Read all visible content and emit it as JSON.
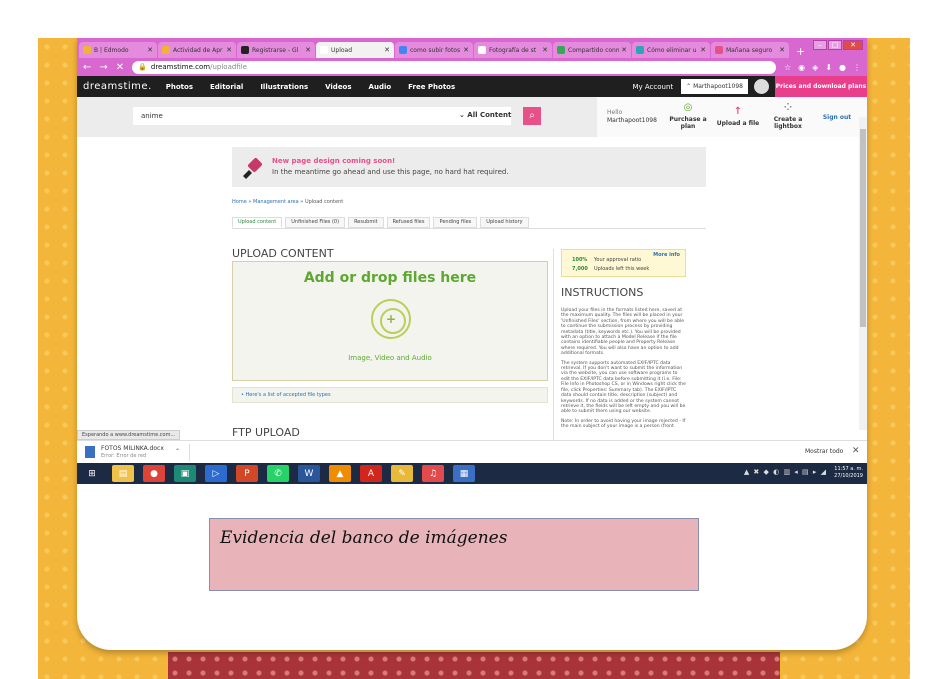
{
  "browser": {
    "tabs": [
      {
        "label": "B | Edmodo",
        "icon_color": "#f2b233",
        "active": false
      },
      {
        "label": "Actividad de Apr",
        "icon_color": "#f2b233",
        "active": false
      },
      {
        "label": "Registrarse - Gl",
        "icon_color": "#222222",
        "active": false
      },
      {
        "label": "Upload",
        "icon_color": "#ffffff",
        "active": true
      },
      {
        "label": "como subir fotos",
        "icon_color": "#4285f4",
        "active": false
      },
      {
        "label": "Fotografía de st",
        "icon_color": "#ffffff",
        "active": false
      },
      {
        "label": "Compartido conm",
        "icon_color": "#34a853",
        "active": false
      },
      {
        "label": "Cómo eliminar u",
        "icon_color": "#2aa6b8",
        "active": false
      },
      {
        "label": "Mañana seguro",
        "icon_color": "#e8508a",
        "active": false
      }
    ],
    "new_tab": "+",
    "url_domain": "dreamstime.com",
    "url_path": "/uploadfile",
    "status_tip": "Esperando a www.dreamstime.com..."
  },
  "site": {
    "logo": "dreamstime.",
    "nav": [
      "Photos",
      "Editorial",
      "Illustrations",
      "Videos",
      "Audio",
      "Free Photos"
    ],
    "my_account": "My Account",
    "username_menu": "⌃ Marthapoot1098",
    "prices": "Prices and download plans",
    "search_value": "anime",
    "content_filter": "⌄ All Content",
    "hello": "Hello",
    "hello_user": "Marthapoot1098",
    "actions": [
      {
        "icon": "◎",
        "label": "Purchase a plan",
        "color": "#5da831"
      },
      {
        "icon": "↑",
        "label": "Upload a file",
        "color": "#e8508a"
      },
      {
        "icon": "⁘",
        "label": "Create a lightbox",
        "color": "#888888"
      }
    ],
    "sign_out": "Sign out"
  },
  "notice": {
    "title": "New page design coming soon!",
    "text": "In the meantime go ahead and use this page, no hard hat required."
  },
  "breadcrumb": {
    "home": "Home",
    "management": "Management area",
    "current": "Upload content",
    "sep": "»"
  },
  "subtabs": [
    {
      "label": "Upload content",
      "active": true
    },
    {
      "label": "Unfinished Files (0)",
      "active": false
    },
    {
      "label": "Resubmit",
      "active": false
    },
    {
      "label": "Refused files",
      "active": false
    },
    {
      "label": "Pending files",
      "active": false
    },
    {
      "label": "Upload history",
      "active": false
    }
  ],
  "upload": {
    "heading": "UPLOAD CONTENT",
    "drop_title": "Add or drop files here",
    "drop_subtitle": "Image, Video and Audio",
    "accepted_link": "Here's a list of accepted file types",
    "ftp_heading": "FTP UPLOAD"
  },
  "ratio": {
    "more_info": "More info",
    "ratio_value": "100%",
    "ratio_label": "Your approval ratio",
    "uploads_value": "7,000",
    "uploads_label": "Uploads left this week"
  },
  "instructions": {
    "heading": "INSTRUCTIONS",
    "p1": "Upload your files in the formats listed here, saved at the maximum quality. The files will be placed in your 'Unfinished Files' section, from where you will be able to continue the submission process by providing metadata (title, keywords etc.). You will be provided with an option to attach a Model Release if the file contains identifiable people and Property Release where required. You will also have an option to add additional formats.",
    "p2": "The system supports automated EXIF/IPTC data retrieval. If you don't want to submit the information via the website, you can use software programs to edit the EXIF/IPTC data before submitting it (i.e. File: File Info in Photoshop CS, or in Windows right click the file, click Properties: Summary tab). The EXIF/IPTC data should contain title, description (subject) and keywords. If no data is added or the system cannot retrieve it, the fields will be left empty and you will be able to submit them using our website.",
    "p3": "Note: In order to avoid having your image rejected - If the main subject of your image is a person (front"
  },
  "downloads": {
    "file_name": "FOTOS MILINKA.docx",
    "file_status": "Error: Error de red",
    "show_all": "Mostrar todo",
    "close": "✕"
  },
  "taskbar": {
    "apps": [
      {
        "name": "windows-start",
        "color": "#1c2a44",
        "glyph": "⊞"
      },
      {
        "name": "file-explorer",
        "color": "#f0c24a",
        "glyph": "▤"
      },
      {
        "name": "chrome",
        "color": "#db4437",
        "glyph": "●"
      },
      {
        "name": "app-green",
        "color": "#1c8a74",
        "glyph": "▣"
      },
      {
        "name": "app-blue",
        "color": "#2d6bcf",
        "glyph": "▷"
      },
      {
        "name": "powerpoint",
        "color": "#d24726",
        "glyph": "P"
      },
      {
        "name": "whatsapp",
        "color": "#25d366",
        "glyph": "✆"
      },
      {
        "name": "word",
        "color": "#2b579a",
        "glyph": "W"
      },
      {
        "name": "vlc",
        "color": "#f08c00",
        "glyph": "▲"
      },
      {
        "name": "acrobat",
        "color": "#d0261c",
        "glyph": "A"
      },
      {
        "name": "paint",
        "color": "#e9b93a",
        "glyph": "✎"
      },
      {
        "name": "music",
        "color": "#e24b4b",
        "glyph": "♫"
      },
      {
        "name": "photos",
        "color": "#3b6fc4",
        "glyph": "▦"
      }
    ],
    "tray": "▲ ✖ ◆ ◐ ▥ ◂ ▤ ▸ ◢",
    "time": "11:57 a. m.",
    "date": "27/10/2019"
  },
  "caption": "Evidencia del banco de imágenes",
  "colors": {
    "accent": "#e8508a",
    "browser_frame": "#d867cf",
    "drop_green": "#5da831",
    "slide_orange": "#f3b53a",
    "caption_box": "#e8b4b9"
  }
}
